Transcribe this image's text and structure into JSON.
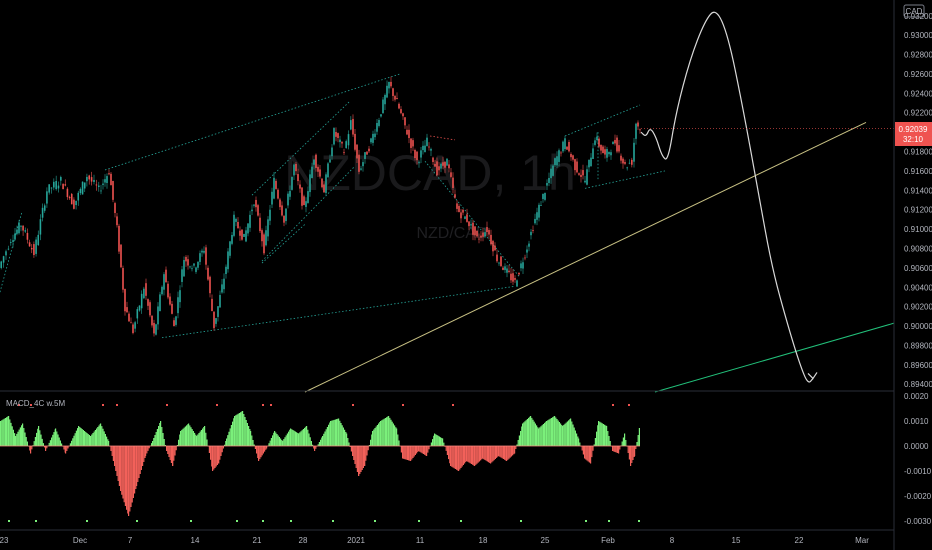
{
  "watermark": {
    "symbol": "NZDCAD, 1h",
    "description": "NZD/CAD"
  },
  "currency_badge": "CAD",
  "price_tag": {
    "value": "0.92039",
    "countdown": "32:10"
  },
  "macd_panel": {
    "title": "MACD_4C w.5M"
  },
  "colors": {
    "background": "#000000",
    "candle_up": "#26a69a",
    "candle_down": "#ef5350",
    "hist_pos": "#7bf07b",
    "hist_neg": "#f2615a",
    "channel": "#26a69a",
    "trendline": "#c7c083",
    "projection": "#d8d8d8",
    "price_tag": "#ef5350"
  },
  "chart_data": [
    {
      "type": "candlestick",
      "title": "",
      "x_ticks": [
        "23",
        "Dec",
        "7",
        "14",
        "21",
        "28",
        "2021",
        "11",
        "18",
        "25",
        "Feb",
        "8",
        "15",
        "22",
        "Mar"
      ],
      "y_ticks": [
        "0.93200",
        "0.93000",
        "0.92800",
        "0.92600",
        "0.92400",
        "0.92200",
        "0.92000",
        "0.91800",
        "0.91600",
        "0.91400",
        "0.91200",
        "0.91000",
        "0.90800",
        "0.90600",
        "0.90400",
        "0.90200",
        "0.90000",
        "0.89800",
        "0.89600",
        "0.89400"
      ],
      "ylim": [
        0.8932,
        0.9328
      ],
      "last_price": 0.92039,
      "price_path": [
        {
          "x": 0,
          "y": 0.906
        },
        {
          "x": 12,
          "y": 0.909
        },
        {
          "x": 22,
          "y": 0.9105
        },
        {
          "x": 35,
          "y": 0.9075
        },
        {
          "x": 48,
          "y": 0.914
        },
        {
          "x": 62,
          "y": 0.915
        },
        {
          "x": 75,
          "y": 0.9125
        },
        {
          "x": 88,
          "y": 0.9155
        },
        {
          "x": 100,
          "y": 0.914
        },
        {
          "x": 110,
          "y": 0.916
        },
        {
          "x": 118,
          "y": 0.91
        },
        {
          "x": 126,
          "y": 0.902
        },
        {
          "x": 134,
          "y": 0.8995
        },
        {
          "x": 145,
          "y": 0.904
        },
        {
          "x": 155,
          "y": 0.899
        },
        {
          "x": 165,
          "y": 0.9055
        },
        {
          "x": 175,
          "y": 0.9
        },
        {
          "x": 185,
          "y": 0.907
        },
        {
          "x": 195,
          "y": 0.906
        },
        {
          "x": 205,
          "y": 0.908
        },
        {
          "x": 215,
          "y": 0.9
        },
        {
          "x": 225,
          "y": 0.905
        },
        {
          "x": 235,
          "y": 0.911
        },
        {
          "x": 245,
          "y": 0.909
        },
        {
          "x": 255,
          "y": 0.913
        },
        {
          "x": 265,
          "y": 0.908
        },
        {
          "x": 275,
          "y": 0.915
        },
        {
          "x": 285,
          "y": 0.911
        },
        {
          "x": 295,
          "y": 0.9165
        },
        {
          "x": 305,
          "y": 0.912
        },
        {
          "x": 315,
          "y": 0.9175
        },
        {
          "x": 325,
          "y": 0.914
        },
        {
          "x": 335,
          "y": 0.92
        },
        {
          "x": 345,
          "y": 0.918
        },
        {
          "x": 352,
          "y": 0.921
        },
        {
          "x": 360,
          "y": 0.916
        },
        {
          "x": 370,
          "y": 0.9185
        },
        {
          "x": 380,
          "y": 0.9215
        },
        {
          "x": 390,
          "y": 0.925
        },
        {
          "x": 398,
          "y": 0.923
        },
        {
          "x": 408,
          "y": 0.92
        },
        {
          "x": 418,
          "y": 0.917
        },
        {
          "x": 428,
          "y": 0.919
        },
        {
          "x": 438,
          "y": 0.916
        },
        {
          "x": 448,
          "y": 0.917
        },
        {
          "x": 458,
          "y": 0.912
        },
        {
          "x": 468,
          "y": 0.911
        },
        {
          "x": 478,
          "y": 0.909
        },
        {
          "x": 488,
          "y": 0.91
        },
        {
          "x": 498,
          "y": 0.907
        },
        {
          "x": 508,
          "y": 0.9055
        },
        {
          "x": 516,
          "y": 0.9045
        },
        {
          "x": 526,
          "y": 0.9075
        },
        {
          "x": 536,
          "y": 0.911
        },
        {
          "x": 546,
          "y": 0.914
        },
        {
          "x": 556,
          "y": 0.917
        },
        {
          "x": 566,
          "y": 0.919
        },
        {
          "x": 576,
          "y": 0.9165
        },
        {
          "x": 586,
          "y": 0.915
        },
        {
          "x": 596,
          "y": 0.9195
        },
        {
          "x": 606,
          "y": 0.9175
        },
        {
          "x": 616,
          "y": 0.919
        },
        {
          "x": 626,
          "y": 0.9165
        },
        {
          "x": 633,
          "y": 0.917
        },
        {
          "x": 637,
          "y": 0.921
        },
        {
          "x": 641,
          "y": 0.92039
        }
      ],
      "projection_path": [
        {
          "x": 641,
          "y": 0.92
        },
        {
          "x": 646,
          "y": 0.9195
        },
        {
          "x": 650,
          "y": 0.9205
        },
        {
          "x": 656,
          "y": 0.9195
        },
        {
          "x": 662,
          "y": 0.9175
        },
        {
          "x": 668,
          "y": 0.917
        },
        {
          "x": 676,
          "y": 0.922
        },
        {
          "x": 690,
          "y": 0.9275
        },
        {
          "x": 705,
          "y": 0.9315
        },
        {
          "x": 716,
          "y": 0.9328
        },
        {
          "x": 728,
          "y": 0.93
        },
        {
          "x": 742,
          "y": 0.923
        },
        {
          "x": 758,
          "y": 0.914
        },
        {
          "x": 772,
          "y": 0.906
        },
        {
          "x": 788,
          "y": 0.9
        },
        {
          "x": 800,
          "y": 0.896
        },
        {
          "x": 808,
          "y": 0.894
        },
        {
          "x": 813,
          "y": 0.8946
        }
      ]
    },
    {
      "type": "bar",
      "title": "MACD_4C w.5M",
      "y_ticks": [
        "0.0020",
        "0.0010",
        "0.0000",
        "-0.0010",
        "-0.0020",
        "-0.0030"
      ],
      "ylim": [
        -0.0032,
        0.002
      ],
      "histogram": [
        {
          "x": 0,
          "y": 0.001
        },
        {
          "x": 8,
          "y": 0.0012
        },
        {
          "x": 15,
          "y": 0.0004
        },
        {
          "x": 22,
          "y": 0.0009
        },
        {
          "x": 30,
          "y": -0.0003
        },
        {
          "x": 38,
          "y": 0.0008
        },
        {
          "x": 45,
          "y": -0.0002
        },
        {
          "x": 55,
          "y": 0.0007
        },
        {
          "x": 65,
          "y": -0.0003
        },
        {
          "x": 78,
          "y": 0.0008
        },
        {
          "x": 90,
          "y": 0.0004
        },
        {
          "x": 100,
          "y": 0.0009
        },
        {
          "x": 108,
          "y": 0.0002
        },
        {
          "x": 114,
          "y": -0.0008
        },
        {
          "x": 120,
          "y": -0.0018
        },
        {
          "x": 128,
          "y": -0.0028
        },
        {
          "x": 136,
          "y": -0.0016
        },
        {
          "x": 145,
          "y": -0.0004
        },
        {
          "x": 152,
          "y": 0.0002
        },
        {
          "x": 160,
          "y": 0.001
        },
        {
          "x": 166,
          "y": -0.0002
        },
        {
          "x": 172,
          "y": -0.0008
        },
        {
          "x": 180,
          "y": 0.0006
        },
        {
          "x": 188,
          "y": 0.0009
        },
        {
          "x": 196,
          "y": 0.0004
        },
        {
          "x": 204,
          "y": 0.0008
        },
        {
          "x": 212,
          "y": -0.001
        },
        {
          "x": 218,
          "y": -0.0007
        },
        {
          "x": 226,
          "y": 0.0003
        },
        {
          "x": 234,
          "y": 0.0012
        },
        {
          "x": 242,
          "y": 0.0014
        },
        {
          "x": 250,
          "y": 0.0006
        },
        {
          "x": 258,
          "y": -0.0006
        },
        {
          "x": 266,
          "y": -0.0001
        },
        {
          "x": 274,
          "y": 0.0006
        },
        {
          "x": 282,
          "y": 0.0002
        },
        {
          "x": 290,
          "y": 0.0007
        },
        {
          "x": 298,
          "y": 0.0005
        },
        {
          "x": 306,
          "y": 0.0008
        },
        {
          "x": 314,
          "y": -0.0002
        },
        {
          "x": 322,
          "y": 0.0004
        },
        {
          "x": 330,
          "y": 0.001
        },
        {
          "x": 338,
          "y": 0.0011
        },
        {
          "x": 346,
          "y": 0.0005
        },
        {
          "x": 352,
          "y": -0.0004
        },
        {
          "x": 358,
          "y": -0.0012
        },
        {
          "x": 364,
          "y": -0.0008
        },
        {
          "x": 372,
          "y": 0.0006
        },
        {
          "x": 380,
          "y": 0.001
        },
        {
          "x": 388,
          "y": 0.0012
        },
        {
          "x": 396,
          "y": 0.0007
        },
        {
          "x": 402,
          "y": -0.0005
        },
        {
          "x": 410,
          "y": -0.0006
        },
        {
          "x": 418,
          "y": -0.0002
        },
        {
          "x": 426,
          "y": -0.0004
        },
        {
          "x": 434,
          "y": 0.0005
        },
        {
          "x": 442,
          "y": 0.0003
        },
        {
          "x": 450,
          "y": -0.0008
        },
        {
          "x": 458,
          "y": -0.001
        },
        {
          "x": 466,
          "y": -0.0006
        },
        {
          "x": 474,
          "y": -0.0008
        },
        {
          "x": 482,
          "y": -0.0005
        },
        {
          "x": 490,
          "y": -0.0007
        },
        {
          "x": 498,
          "y": -0.0004
        },
        {
          "x": 506,
          "y": -0.0006
        },
        {
          "x": 514,
          "y": -0.0003
        },
        {
          "x": 522,
          "y": 0.0009
        },
        {
          "x": 530,
          "y": 0.0012
        },
        {
          "x": 538,
          "y": 0.0007
        },
        {
          "x": 546,
          "y": 0.001
        },
        {
          "x": 554,
          "y": 0.0012
        },
        {
          "x": 562,
          "y": 0.0008
        },
        {
          "x": 570,
          "y": 0.0011
        },
        {
          "x": 578,
          "y": 0.0003
        },
        {
          "x": 584,
          "y": -0.0005
        },
        {
          "x": 590,
          "y": -0.0007
        },
        {
          "x": 598,
          "y": 0.001
        },
        {
          "x": 606,
          "y": 0.0008
        },
        {
          "x": 612,
          "y": -0.0002
        },
        {
          "x": 618,
          "y": -0.0003
        },
        {
          "x": 624,
          "y": 0.0005
        },
        {
          "x": 630,
          "y": -0.0008
        },
        {
          "x": 634,
          "y": -0.0004
        },
        {
          "x": 640,
          "y": 0.001
        }
      ]
    }
  ]
}
